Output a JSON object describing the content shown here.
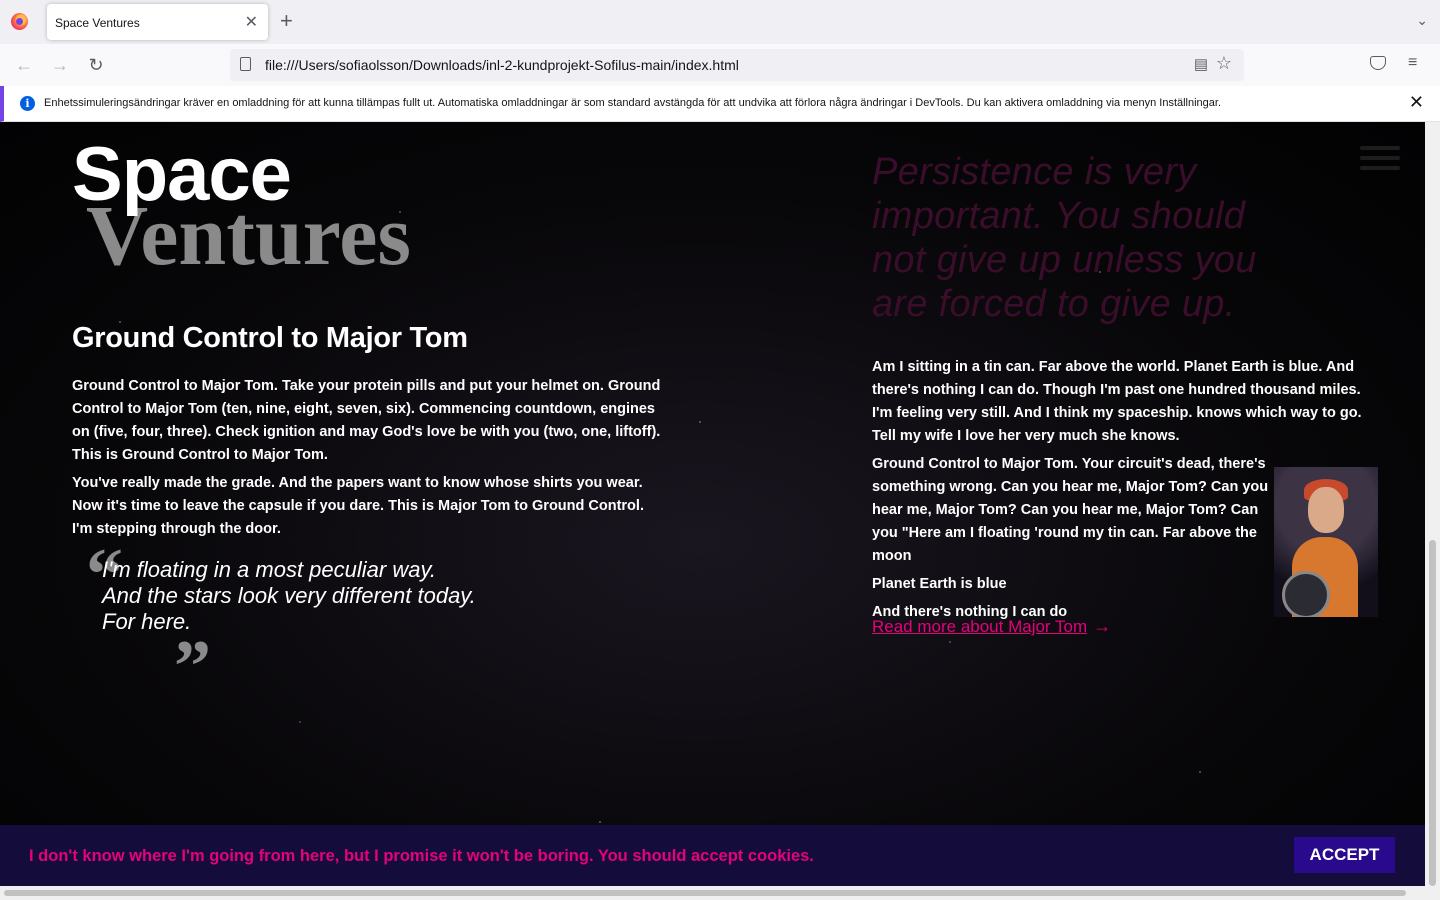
{
  "browser": {
    "tab_title": "Space Ventures",
    "tab_close": "✕",
    "new_tab": "+",
    "tab_list": "⌄",
    "url": "file:///Users/sofiaolsson/Downloads/inl-2-kundprojekt-Sofilus-main/index.html",
    "back": "←",
    "forward": "→",
    "reload": "↻",
    "reader": "▤",
    "star": "☆",
    "menu": "≡"
  },
  "infobar": {
    "icon": "i",
    "text": "Enhetssimuleringsändringar kräver en omladdning för att kunna tillämpas fullt ut. Automatiska omladdningar är som standard avstängda för att undvika att förlora några ändringar i DevTools. Du kan aktivera omladdning via menyn Inställningar.",
    "close": "✕"
  },
  "logo": {
    "line1": "Space",
    "line2": "Ventures"
  },
  "left": {
    "heading": "Ground Control to Major Tom",
    "paragraphs": [
      "Ground Control to Major Tom. Take your protein pills and put your helmet on. Ground Control to Major Tom (ten, nine, eight, seven, six). Commencing countdown, engines on (five, four, three). Check ignition and may God's love be with you (two, one, liftoff). This is Ground Control to Major Tom.",
      "You've really made the grade. And the papers want to know whose shirts you wear. Now it's time to leave the capsule if you dare. This is Major Tom to Ground Control. I'm stepping through the door."
    ],
    "quote": {
      "open": "“",
      "close": "”",
      "lines": [
        "I'm floating in a most peculiar way.",
        "And the stars look very different today.",
        "For here."
      ]
    }
  },
  "right": {
    "big_quote": "Persistence is very important. You should not give up unless you are forced to give up.",
    "paragraphs": [
      "Am I sitting in a tin can. Far above the world. Planet Earth is blue. And there's nothing I can do. Though I'm past one hundred thousand miles. I'm feeling very still. And I think my spaceship. knows which way to go. Tell my wife I love her very much she knows.",
      "Ground Control to Major Tom. Your circuit's dead, there's something wrong. Can you hear me, Major Tom? Can you hear me, Major Tom? Can you hear me, Major Tom? Can you \"Here am I floating 'round my tin can. Far above the moon",
      "Planet Earth is blue",
      "And there's nothing I can do"
    ],
    "read_more": "Read more about Major Tom",
    "arrow": "→"
  },
  "cookie": {
    "text": "I don't know where I'm going from here, but I promise it won't be boring. You should accept cookies.",
    "button": "ACCEPT"
  }
}
